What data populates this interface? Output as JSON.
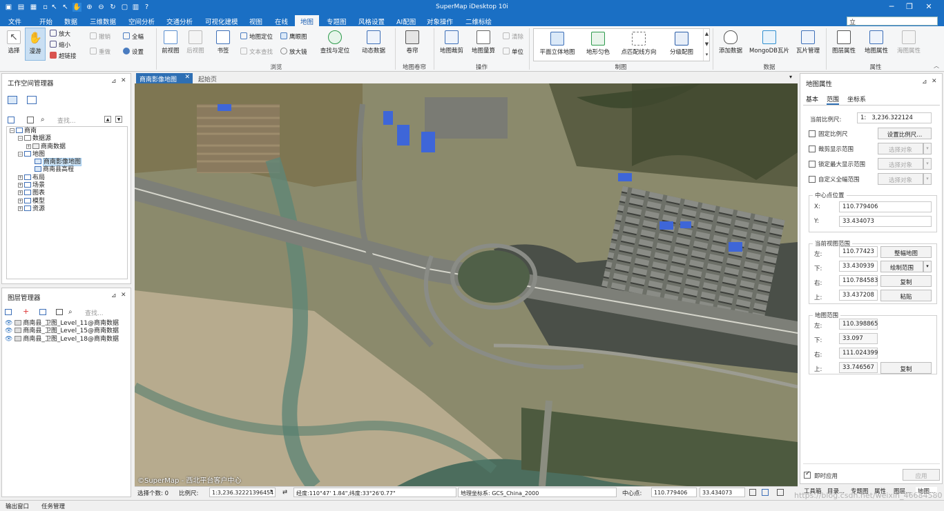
{
  "app": {
    "title": "SuperMap iDesktop 10i",
    "search_value": "立",
    "watermark": "https://blog.csdn.net/weixin_46684580"
  },
  "menu": [
    "文件",
    "开始",
    "数据",
    "三维数据",
    "空间分析",
    "交通分析",
    "可视化建模",
    "视图",
    "在线",
    "地图",
    "专题图",
    "风格设置",
    "AI配图",
    "对象操作",
    "二维标绘"
  ],
  "menu_active": "地图",
  "ribbon": {
    "select": "选择",
    "pan": "漫游",
    "zoom_in": "放大",
    "zoom_out": "缩小",
    "hyperlink": "超链接",
    "undo": "撤销",
    "redo": "重做",
    "full_extent": "全幅",
    "settings": "设置",
    "prev_view": "前视图",
    "next_view": "后视图",
    "bookmark": "书签",
    "map_locate": "地图定位",
    "text_find": "文本查找",
    "eagle_eye": "鹰眼图",
    "magnifier": "放大镜",
    "find_locate": "查找与定位",
    "dynamic_data": "动态数据",
    "group_browse": "浏览",
    "roller": "卷帘",
    "group_roller": "地图卷帘",
    "map_clip": "地图裁剪",
    "map_calc": "地图量算",
    "clear": "清除",
    "unit": "单位",
    "group_ops": "操作",
    "gallery": [
      "平面立体地图",
      "地形匀色",
      "点匹配线方向",
      "分级配图"
    ],
    "group_mapping": "制图",
    "add_data": "添加数据",
    "mongodb_tiles": "MongoDB瓦片",
    "tile_mgmt": "瓦片管理",
    "group_data": "数据",
    "layer_props": "图层属性",
    "map_props": "地图属性",
    "chart_props": "海图属性",
    "group_props": "属性"
  },
  "workspace": {
    "title": "工作空间管理器",
    "search_placeholder": "查找...",
    "tree": [
      "商南",
      "数据源",
      "商南数据",
      "地图",
      "商南影像地图",
      "商南县高程",
      "布局",
      "场景",
      "图表",
      "模型",
      "资源"
    ]
  },
  "layers": {
    "title": "图层管理器",
    "search_placeholder": "查找...",
    "items": [
      "商南县_卫图_Level_11@商南数据",
      "商南县_卫图_Level_15@商南数据",
      "商南县_卫图_Level_18@商南数据"
    ]
  },
  "map": {
    "tabs": [
      "商南影像地图",
      "起始页"
    ],
    "copyright": "©SuperMap - 西北平台客户中心"
  },
  "props": {
    "title": "地图属性",
    "tabs": [
      "基本",
      "范围",
      "坐标系"
    ],
    "scale_label": "当前比例尺:",
    "scale_prefix": "1:",
    "scale_value": "3,236.322124",
    "fixed_scale": "固定比例尺",
    "set_scale": "设置比例尺...",
    "clip_display": "裁剪显示范围",
    "lock_max": "锁定最大显示范围",
    "custom_full": "自定义全幅范围",
    "select_object": "选择对象",
    "center_title": "中心点位置",
    "x_label": "X:",
    "y_label": "Y:",
    "center_x": "110.779406",
    "center_y": "33.434073",
    "view_title": "当前视图范围",
    "left": "左:",
    "bottom": "下:",
    "right": "右:",
    "top": "上:",
    "view_left": "110.77423",
    "view_bottom": "33.430939",
    "view_right": "110.784583",
    "view_top": "33.437208",
    "full_map": "整幅地图",
    "draw_extent": "绘制范围",
    "copy": "复制",
    "paste": "粘贴",
    "map_title": "地图范围",
    "map_left": "110.398865",
    "map_bottom": "33.097",
    "map_right": "111.024399",
    "map_top": "33.746567",
    "instant_apply": "即时应用",
    "apply": "应用"
  },
  "status": {
    "selected": "选择个数: 0",
    "scale_label": "比例尺:",
    "scale_value": "1:3,236.32221396454",
    "coords": "经度:110°47' 1.84\",纬度:33°26'0.77\"",
    "crs": "地理坐标系: GCS_China_2000",
    "center_label": "中心点:",
    "center_x": "110.779406",
    "center_y": "33.434073"
  },
  "right_tabs": [
    "工具箱",
    "目录...",
    "专题图",
    "属性",
    "图层...",
    "地图..."
  ],
  "bottom_tabs": [
    "输出窗口",
    "任务管理"
  ]
}
